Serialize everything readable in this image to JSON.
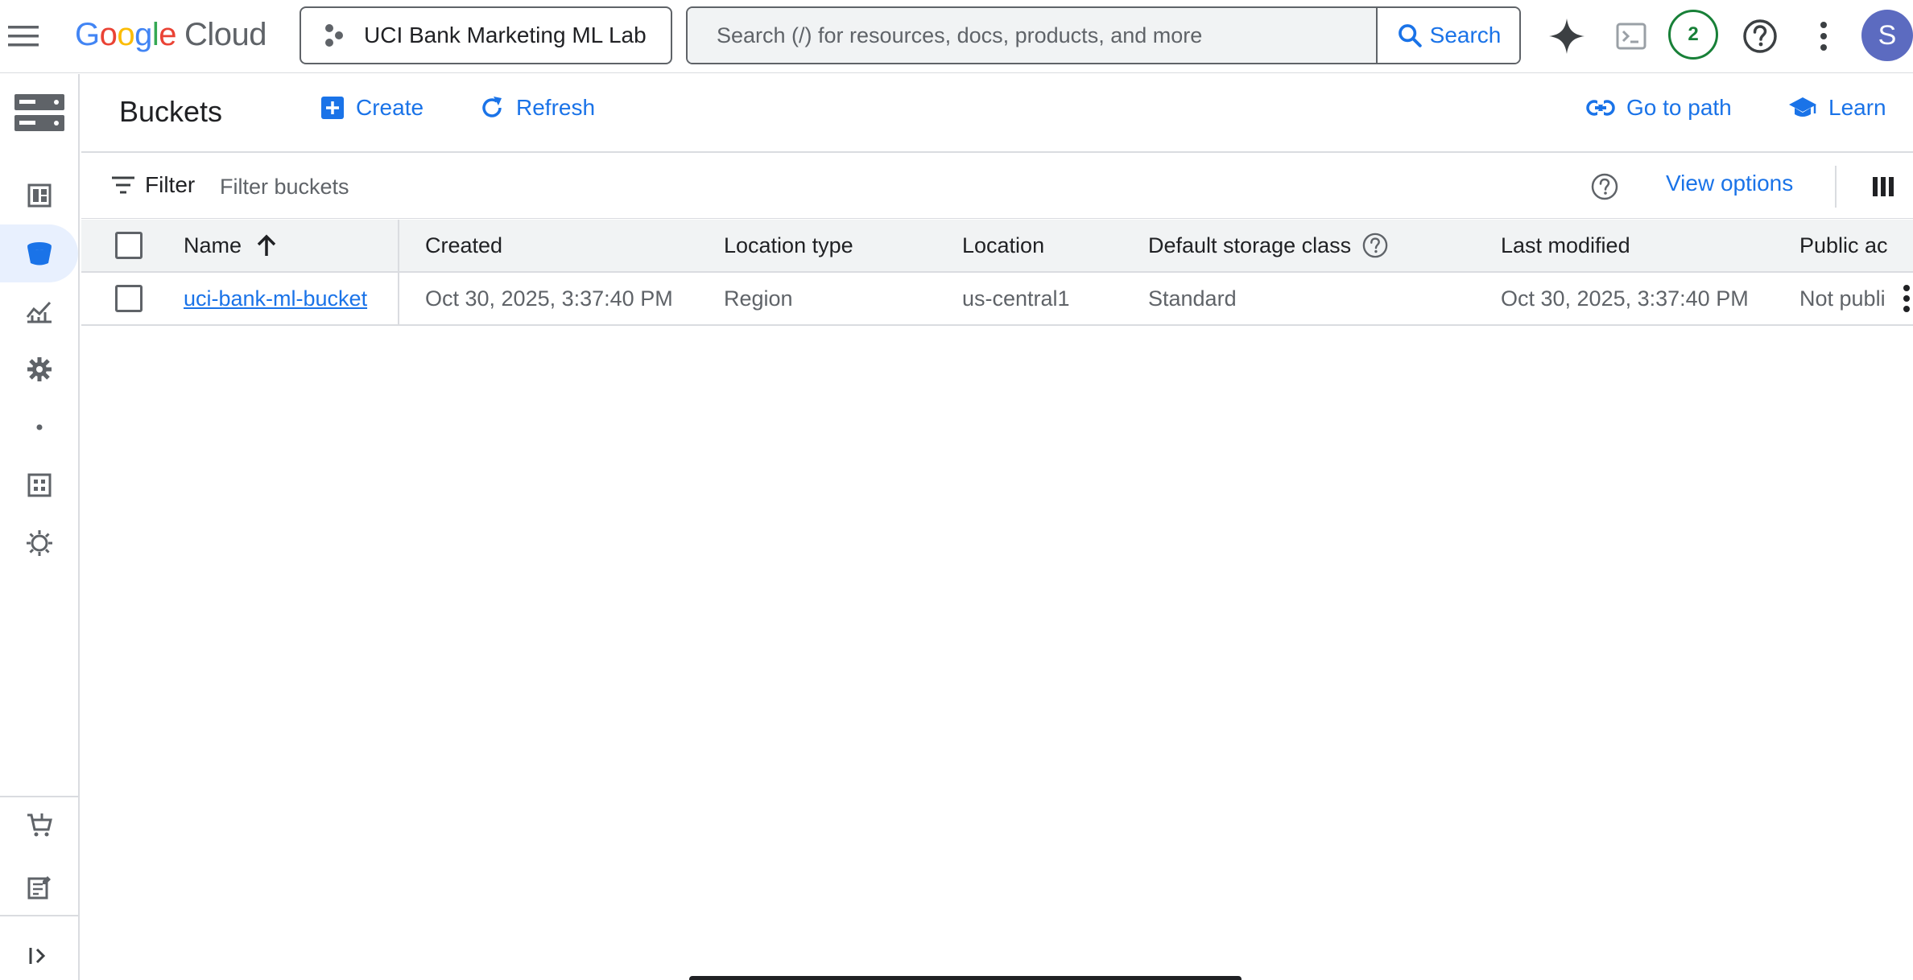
{
  "topbar": {
    "logo_google": [
      "G",
      "o",
      "o",
      "g",
      "l",
      "e"
    ],
    "logo_cloud": "Cloud",
    "project_name": "UCI Bank Marketing ML Lab",
    "search_placeholder": "Search (/) for resources, docs, products, and more",
    "search_button": "Search",
    "notifications_count": "2",
    "avatar_initial": "S"
  },
  "page": {
    "title": "Buckets",
    "actions": {
      "create": "Create",
      "refresh": "Refresh",
      "go_to_path": "Go to path",
      "learn": "Learn"
    }
  },
  "filter": {
    "label": "Filter",
    "placeholder": "Filter buckets",
    "view_options": "View options"
  },
  "table": {
    "columns": {
      "name": "Name",
      "created": "Created",
      "location_type": "Location type",
      "location": "Location",
      "default_storage_class": "Default storage class",
      "last_modified": "Last modified",
      "public_access": "Public ac"
    },
    "rows": [
      {
        "name": "uci-bank-ml-bucket",
        "created": "Oct 30, 2025, 3:37:40 PM",
        "location_type": "Region",
        "location": "us-central1",
        "default_storage_class": "Standard",
        "last_modified": "Oct 30, 2025, 3:37:40 PM",
        "public_access": "Not publi"
      }
    ]
  },
  "colors": {
    "accent": "#1a73e8",
    "text_primary": "#202124",
    "text_secondary": "#5f6368",
    "border": "#dadce0",
    "header_bg": "#f1f3f4",
    "notification": "#188038",
    "avatar": "#5c6bc0"
  }
}
